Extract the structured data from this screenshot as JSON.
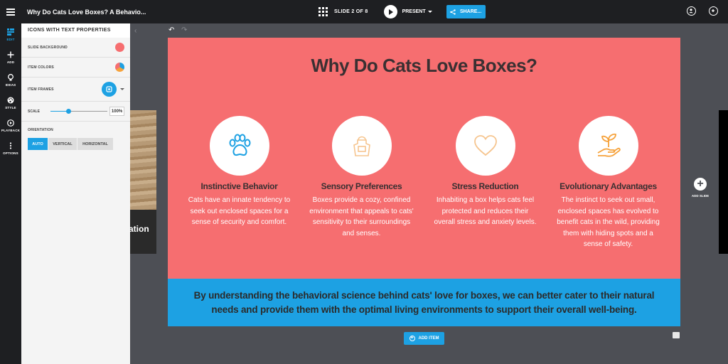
{
  "topbar": {
    "doc_title": "Why Do Cats Love Boxes? A Behavio...",
    "slide_count": "SLIDE 2 OF 8",
    "present_label": "PRESENT",
    "share_label": "SHARE..."
  },
  "rail": [
    {
      "label": "EDIT",
      "icon": "edit-icon"
    },
    {
      "label": "ADD",
      "icon": "plus-icon"
    },
    {
      "label": "IDEAS",
      "icon": "lightbulb-icon"
    },
    {
      "label": "STYLE",
      "icon": "palette-icon"
    },
    {
      "label": "PLAYBACK",
      "icon": "play-circle-icon"
    },
    {
      "label": "OPTIONS",
      "icon": "dots-vertical-icon"
    }
  ],
  "panel": {
    "title": "ICONS WITH TEXT PROPERTIES",
    "slide_background_label": "SLIDE BACKGROUND",
    "item_colors_label": "ITEM COLORS",
    "item_frames_label": "ITEM FRAMES",
    "scale_label": "SCALE",
    "scale_value": "100%",
    "orientation_label": "ORIENTATION",
    "orientation_options": [
      "AUTO",
      "VERTICAL",
      "HORIZONTAL"
    ],
    "orientation_selected": "AUTO"
  },
  "thumb": {
    "text": "ation"
  },
  "slide": {
    "title": "Why Do Cats Love Boxes?",
    "background": "#f66e70",
    "items": [
      {
        "icon": "paw-icon",
        "heading": "Instinctive Behavior",
        "body": "Cats have an innate tendency to seek out enclosed spaces for a sense of security and comfort."
      },
      {
        "icon": "apron-icon",
        "heading": "Sensory Preferences",
        "body": "Boxes provide a cozy, confined environment that appeals to cats' sensitivity to their surroundings and senses."
      },
      {
        "icon": "heart-icon",
        "heading": "Stress Reduction",
        "body": "Inhabiting a box helps cats feel protected and reduces their overall stress and anxiety levels."
      },
      {
        "icon": "sprout-hand-icon",
        "heading": "Evolutionary Advantages",
        "body": "The instinct to seek out small, enclosed spaces has evolved to benefit cats in the wild, providing them with hiding spots and a sense of safety."
      }
    ],
    "banner": "By understanding the behavioral science behind cats' love for boxes, we can better cater to their natural needs and provide them with the optimal living environments to support their overall well-being."
  },
  "add_item_label": "ADD ITEM",
  "add_slide_label": "ADD SLIDE",
  "colors": {
    "accent": "#1da1e3",
    "slide_bg": "#f66e70",
    "icon_blue": "#1da1e3",
    "icon_orange": "#f6a23b"
  }
}
